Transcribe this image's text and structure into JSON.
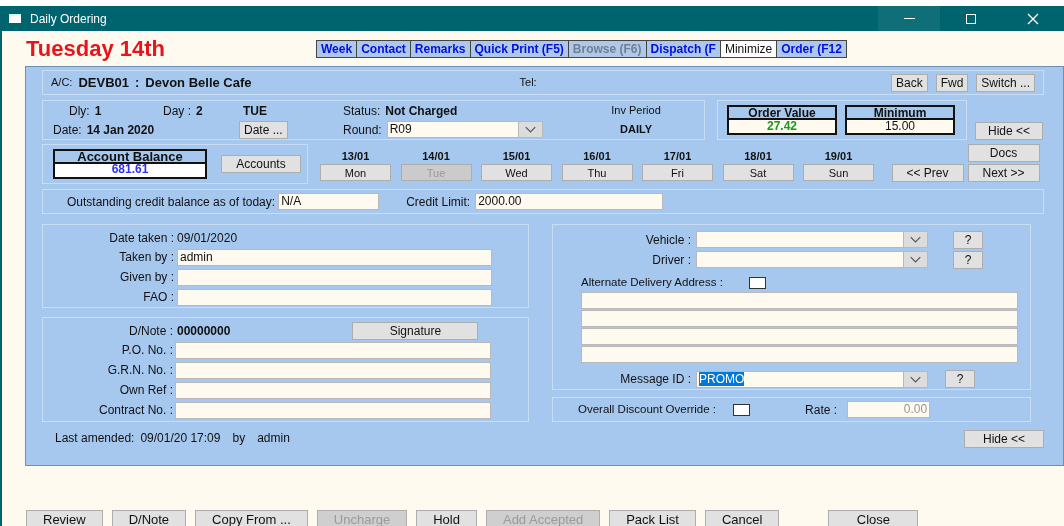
{
  "window": {
    "title": "Daily Ordering"
  },
  "heading": "Tuesday 14th",
  "tabs": [
    {
      "label": "Week",
      "selected": false,
      "disabled": false
    },
    {
      "label": "Contact",
      "selected": false,
      "disabled": false
    },
    {
      "label": "Remarks",
      "selected": false,
      "disabled": false
    },
    {
      "label": "Quick Print (F5)",
      "selected": false,
      "disabled": false
    },
    {
      "label": "Browse (F6)",
      "selected": false,
      "disabled": true
    },
    {
      "label": "Dispatch (F",
      "selected": false,
      "disabled": false
    },
    {
      "label": "Minimize",
      "selected": true,
      "disabled": false
    },
    {
      "label": "Order (F12",
      "selected": false,
      "disabled": false
    }
  ],
  "account": {
    "label": "A/C:",
    "code": "DEVB01",
    "separator": ":",
    "name": "Devon Belle Cafe",
    "tel_label": "Tel:",
    "buttons": [
      "Back",
      "Fwd",
      "Switch ..."
    ]
  },
  "info": {
    "dly_label": "Dly:",
    "dly": "1",
    "day_label": "Day :",
    "day": "2",
    "day_name": "TUE",
    "status_label": "Status:",
    "status": "Not Charged",
    "date_label": "Date:",
    "date": "14 Jan 2020",
    "date_button": "Date ...",
    "round_label": "Round:",
    "round": "R09",
    "inv_period_label": "Inv Period",
    "inv_period": "DAILY"
  },
  "order_value": {
    "label": "Order Value",
    "value": "27.42"
  },
  "minimum": {
    "label": "Minimum",
    "value": "15.00"
  },
  "hide_button": "Hide <<",
  "docs_button": "Docs",
  "account_balance": {
    "label": "Account Balance",
    "value": "681.61"
  },
  "accounts_button": "Accounts",
  "days": [
    {
      "date": "13/01",
      "label": "Mon",
      "disabled": false
    },
    {
      "date": "14/01",
      "label": "Tue",
      "disabled": true
    },
    {
      "date": "15/01",
      "label": "Wed",
      "disabled": false
    },
    {
      "date": "16/01",
      "label": "Thu",
      "disabled": false
    },
    {
      "date": "17/01",
      "label": "Fri",
      "disabled": false
    },
    {
      "date": "18/01",
      "label": "Sat",
      "disabled": false
    },
    {
      "date": "19/01",
      "label": "Sun",
      "disabled": false
    }
  ],
  "prev_button": "<< Prev",
  "next_button": "Next >>",
  "credit": {
    "outstanding_label": "Outstanding credit balance as of today:",
    "outstanding": "N/A",
    "limit_label": "Credit Limit:",
    "limit": "2000.00"
  },
  "taken": {
    "date_label": "Date taken :",
    "date": "09/01/2020",
    "fields": [
      {
        "label": "Taken by :",
        "value": "admin"
      },
      {
        "label": "Given by :"
      },
      {
        "label": "FAO :"
      }
    ]
  },
  "dnote": {
    "label": "D/Note :",
    "value": "00000000",
    "signature_button": "Signature",
    "fields": [
      {
        "label": "P.O. No. :"
      },
      {
        "label": "G.R.N. No. :"
      },
      {
        "label": "Own Ref :"
      },
      {
        "label": "Contract No. :"
      }
    ]
  },
  "last_amended": {
    "label": "Last amended:",
    "time": "09/01/20 17:09",
    "by": "by",
    "user": "admin"
  },
  "delivery": {
    "combos": [
      {
        "label": "Vehicle :",
        "help": "?"
      },
      {
        "label": "Driver :",
        "help": "?"
      }
    ],
    "alt_address_label": "Alternate Delivery Address :",
    "alt_address_checked": false,
    "address_lines": [
      {
        "kind": "text"
      },
      {
        "kind": "text"
      },
      {
        "kind": "text"
      },
      {
        "kind": "text"
      }
    ],
    "message_label": "Message ID :",
    "message": "PROMO",
    "message_highlighted": true,
    "message_help": "?"
  },
  "discount": {
    "label": "Overall Discount Override :",
    "checked": false,
    "rate_label": "Rate :",
    "rate": "0.00"
  },
  "hide_button_2": "Hide <<",
  "footer_buttons": [
    {
      "label": "Review",
      "disabled": false
    },
    {
      "label": "D/Note",
      "disabled": false
    },
    {
      "label": "Copy From ...",
      "disabled": false
    },
    {
      "label": "Uncharge",
      "disabled": true
    },
    {
      "label": "Hold",
      "disabled": false
    },
    {
      "label": "Add Accepted",
      "disabled": true
    },
    {
      "label": "Pack List",
      "disabled": false
    },
    {
      "label": "Cancel",
      "disabled": false
    },
    {
      "label": "Close",
      "disabled": false
    }
  ]
}
